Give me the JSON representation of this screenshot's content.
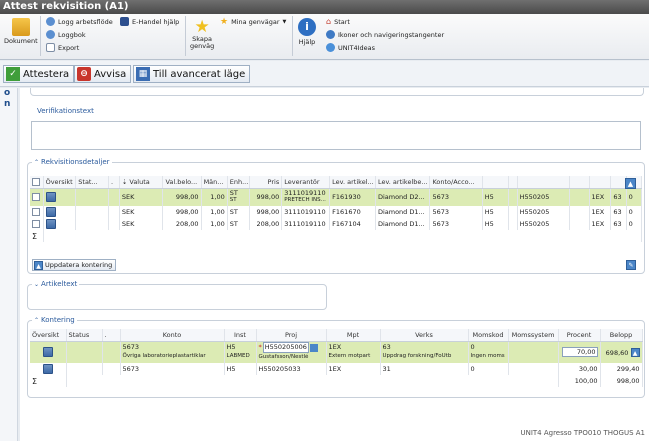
{
  "window": {
    "title": "Attest rekvisition (A1)"
  },
  "ribbon": {
    "dokument": "Dokument",
    "logg_arbetsflode": "Logg arbetsflöde",
    "loggbok": "Loggbok",
    "export": "Export",
    "ehandel_hjalp": "E-Handel hjälp",
    "skapa_genvag_1": "Skapa",
    "skapa_genvag_2": "genväg",
    "mina_genvagar": "Mina genvägar",
    "hjalp": "Hjälp",
    "start": "Start",
    "ikoner": "Ikoner och navigeringstangenter",
    "unit4ideas": "UNIT4Ideas"
  },
  "actions": {
    "attestera": "Attestera",
    "avvisa": "Avvisa",
    "avancerat": "Till avancerat läge"
  },
  "left_strip": {
    "line1": "o",
    "line2": "n"
  },
  "verifikation": {
    "title": "Verifikationstext",
    "value": ""
  },
  "rekv": {
    "title": "Rekvisitionsdetaljer",
    "headers": [
      "",
      "Översikt",
      "Stat...",
      ".",
      "Valuta",
      "Val.belo...",
      "Män...",
      "Enh...",
      "Pris",
      "Leverantör",
      "Lev. artikel...",
      "Lev. artikelbe...",
      "Konto/Acco...",
      "",
      "",
      "",
      "",
      "",
      "",
      ""
    ],
    "rows": [
      {
        "valuta": "SEK",
        "valbelopp": "998,00",
        "antal": "1,00",
        "enhet": "ST",
        "enhet2": "ST",
        "pris": "998,00",
        "leverantor": "3111019110",
        "leverantor2": "PRETECH INS...",
        "levart": "F161930",
        "levbesk": "Diamond D2...",
        "konto": "5673",
        "h": "H5",
        "proj": "H550205",
        "e": "1EX",
        "n": "63",
        "z": "0"
      },
      {
        "valuta": "SEK",
        "valbelopp": "998,00",
        "antal": "1,00",
        "enhet": "ST",
        "enhet2": "",
        "pris": "998,00",
        "leverantor": "3111019110",
        "leverantor2": "",
        "levart": "F161670",
        "levbesk": "Diamond D1...",
        "konto": "5673",
        "h": "H5",
        "proj": "H550205",
        "e": "1EX",
        "n": "63",
        "z": "0"
      },
      {
        "valuta": "SEK",
        "valbelopp": "208,00",
        "antal": "1,00",
        "enhet": "ST",
        "enhet2": "",
        "pris": "208,00",
        "leverantor": "3111019110",
        "leverantor2": "",
        "levart": "F167104",
        "levbesk": "Diamond D1...",
        "konto": "5673",
        "h": "H5",
        "proj": "H550205",
        "e": "1EX",
        "n": "63",
        "z": "0"
      }
    ],
    "sum_symbol": "Σ",
    "uppdatera": "Uppdatera kontering"
  },
  "artikeltext": {
    "title": "Artikeltext"
  },
  "kontering": {
    "title": "Kontering",
    "headers": [
      "Översikt",
      "Status",
      ".",
      "Konto",
      "Inst",
      "Proj",
      "Mpt",
      "Verks",
      "Momskod",
      "Momssystem",
      "Procent",
      "Belopp"
    ],
    "rows": [
      {
        "konto": "5673",
        "konto_desc": "Övriga laboratorieplastartiklar",
        "inst": "H5",
        "inst_desc": "LABMED",
        "proj": "H550205006",
        "proj_desc": "Gustafsson/Nestlé",
        "mpt": "1EX",
        "mpt_desc": "Extern motpart",
        "verks": "63",
        "verks_desc": "Uppdrag forskning/FoUtb",
        "momskod": "0",
        "momskod_desc": "Ingen moms",
        "procent": "70,00",
        "belopp": "698,60"
      },
      {
        "konto": "5673",
        "inst": "H5",
        "proj": "H550205033",
        "mpt": "1EX",
        "verks": "31",
        "momskod": "0",
        "procent": "30,00",
        "belopp": "299,40"
      }
    ],
    "sum_symbol": "Σ",
    "sum_procent": "100,00",
    "sum_belopp": "998,00",
    "required_marker": "*"
  },
  "statusbar": {
    "text": "UNIT4 Agresso   TPO010   THOGUS   A1"
  },
  "colors": {
    "selected_row": "#dcebb4",
    "accent": "#2a5a9c",
    "attestera_green": "#3f9e3a",
    "avvisa_red": "#c8352c"
  }
}
